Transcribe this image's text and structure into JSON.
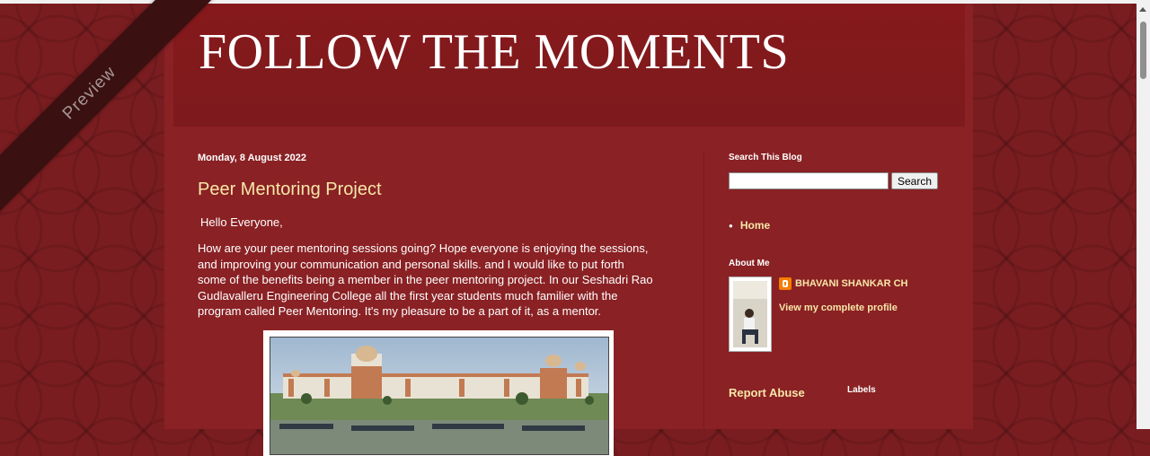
{
  "blog": {
    "title": "FOLLOW THE MOMENTS"
  },
  "ribbon": {
    "label": "Preview"
  },
  "post": {
    "date": "Monday, 8 August 2022",
    "title": "Peer Mentoring Project",
    "greeting": "Hello Everyone,",
    "body": "How are your peer mentoring sessions going? Hope everyone is enjoying the sessions, and improving your communication and personal skills. and I would like to put forth some of the benefits being a member in the peer mentoring project. In our Seshadri Rao Gudlavalleru Engineering College all the first year students much familier with the program called Peer Mentoring. It's my pleasure to be a part of it, as a mentor."
  },
  "sidebar": {
    "search": {
      "title": "Search This Blog",
      "value": "",
      "button": "Search"
    },
    "pages": [
      {
        "label": "Home"
      }
    ],
    "about": {
      "title": "About Me",
      "name": "BHAVANI SHANKAR CH",
      "profile_link": "View my complete profile"
    },
    "report_abuse": "Report Abuse",
    "labels_title": "Labels"
  },
  "colors": {
    "accent": "#f6e7a8",
    "background": "#7a1d20",
    "panel": "#8a2124"
  }
}
